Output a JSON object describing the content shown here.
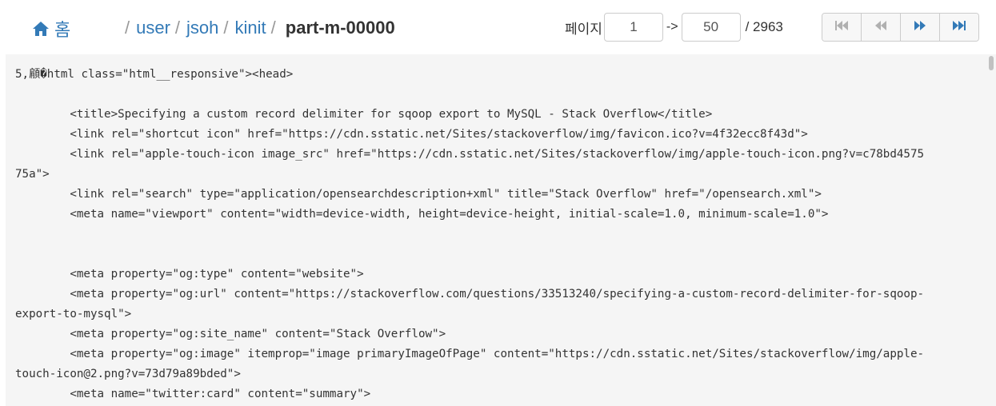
{
  "header": {
    "home_label": "홈",
    "breadcrumb": [
      {
        "label": "user"
      },
      {
        "label": "jsoh"
      },
      {
        "label": "kinit"
      }
    ],
    "current_file": "part-m-00000"
  },
  "pager": {
    "page_label": "페이지",
    "from_value": "1",
    "arrow": "->",
    "to_value": "50",
    "total": "/ 2963"
  },
  "nav_buttons": [
    {
      "icon": "first-page-icon"
    },
    {
      "icon": "previous-page-icon"
    },
    {
      "icon": "next-page-icon"
    },
    {
      "icon": "last-page-icon"
    }
  ],
  "colors": {
    "link": "#337ab7",
    "content_bg": "#f5f5f5",
    "text": "#333333"
  },
  "content_lines": [
    "5,顅�html class=\"html__responsive\"><head>",
    "",
    "        <title>Specifying a custom record delimiter for sqoop export to MySQL - Stack Overflow</title>",
    "        <link rel=\"shortcut icon\" href=\"https://cdn.sstatic.net/Sites/stackoverflow/img/favicon.ico?v=4f32ecc8f43d\">",
    "        <link rel=\"apple-touch-icon image_src\" href=\"https://cdn.sstatic.net/Sites/stackoverflow/img/apple-touch-icon.png?v=c78bd4575",
    "75a\">",
    "        <link rel=\"search\" type=\"application/opensearchdescription+xml\" title=\"Stack Overflow\" href=\"/opensearch.xml\">",
    "        <meta name=\"viewport\" content=\"width=device-width, height=device-height, initial-scale=1.0, minimum-scale=1.0\">",
    "",
    "",
    "        <meta property=\"og:type\" content=\"website\">",
    "        <meta property=\"og:url\" content=\"https://stackoverflow.com/questions/33513240/specifying-a-custom-record-delimiter-for-sqoop-",
    "export-to-mysql\">",
    "        <meta property=\"og:site_name\" content=\"Stack Overflow\">",
    "        <meta property=\"og:image\" itemprop=\"image primaryImageOfPage\" content=\"https://cdn.sstatic.net/Sites/stackoverflow/img/apple-",
    "touch-icon@2.png?v=73d79a89bded\">",
    "        <meta name=\"twitter:card\" content=\"summary\">"
  ]
}
